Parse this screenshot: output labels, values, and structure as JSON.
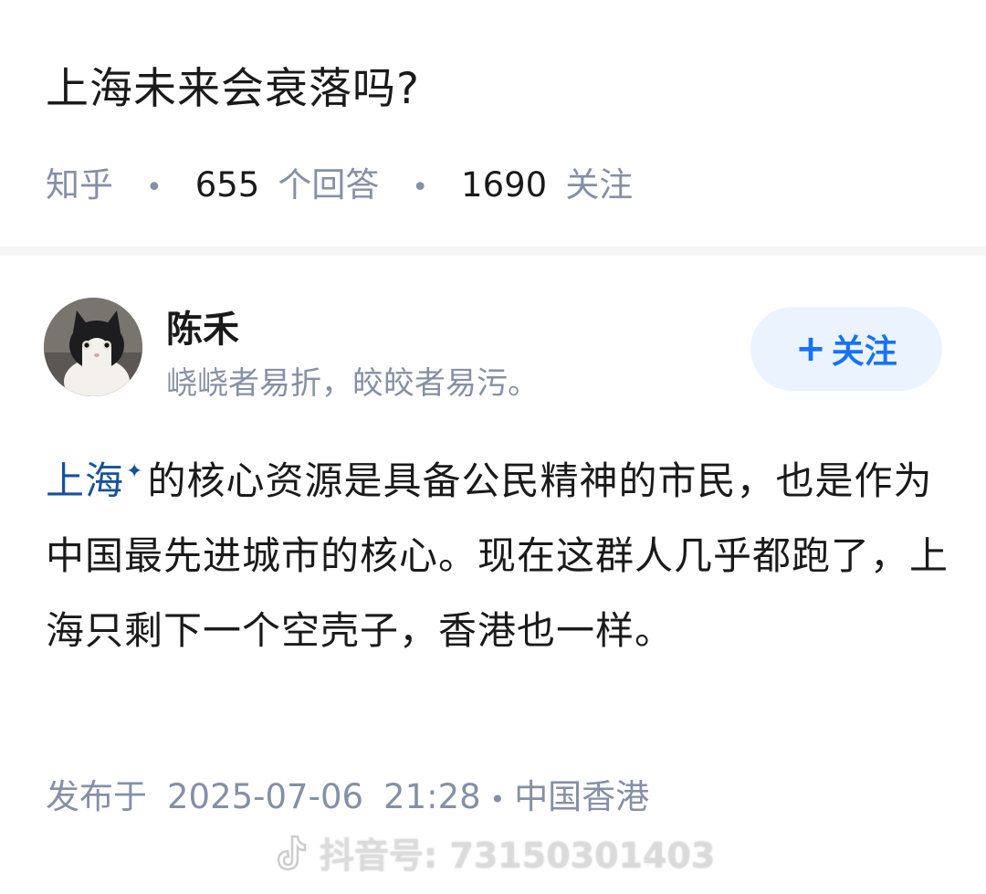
{
  "question": {
    "title": "上海未来会衰落吗?",
    "source": "知乎",
    "answers_count": "655",
    "answers_label": "个回答",
    "followers_count": "1690",
    "followers_label": "关注"
  },
  "author": {
    "name": "陈禾",
    "bio": "峣峣者易折，皎皎者易污。",
    "follow_label": "关注",
    "follow_icon": "plus-icon"
  },
  "answer": {
    "link_text": "上海",
    "link_icon": "sparkle-icon",
    "text": "的核心资源是具备公民精神的市民，也是作为中国最先进城市的核心。现在这群人几乎都跑了，上海只剩下一个空壳子，香港也一样。"
  },
  "footer": {
    "published_label": "发布于",
    "date": "2025-07-06",
    "time": "21:28",
    "location": "中国香港"
  },
  "watermark": {
    "label": "抖音号: 73150301403",
    "icon": "tiktok-icon"
  },
  "colors": {
    "link": "#175199",
    "follow_text": "#1772f6",
    "follow_bg": "#ebf3ff",
    "meta_gray": "#8590a6",
    "text_dark": "#1a1a1a"
  }
}
